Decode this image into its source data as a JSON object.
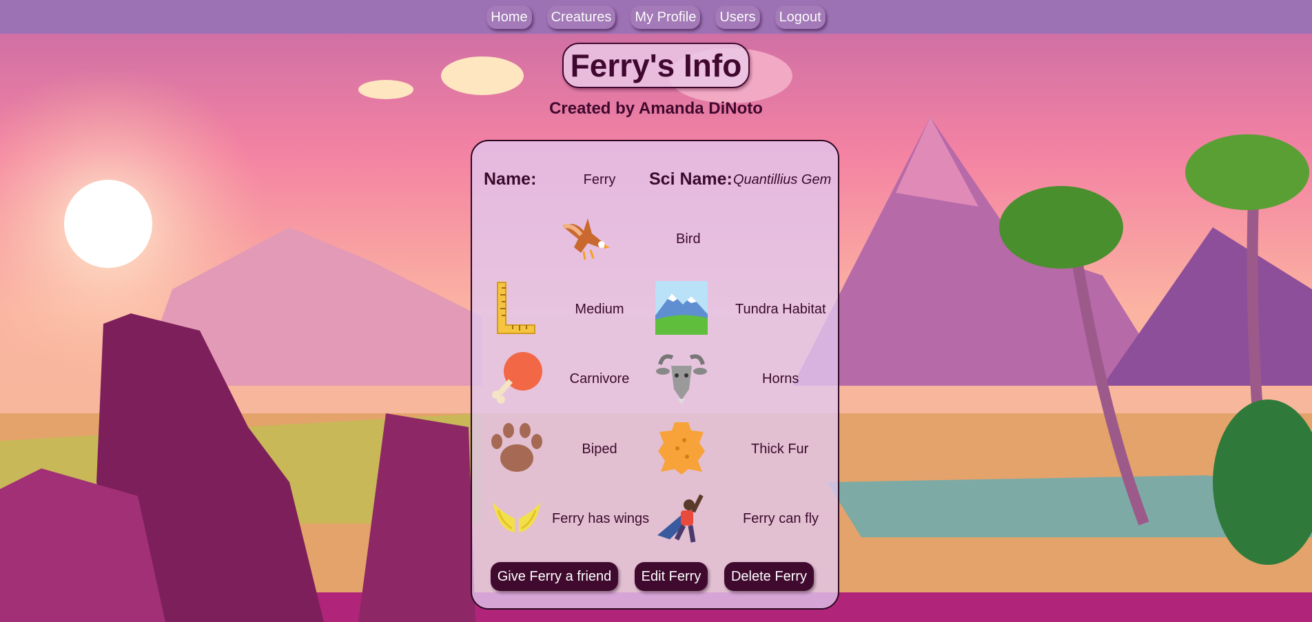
{
  "nav": {
    "items": [
      {
        "label": "Home"
      },
      {
        "label": "Creatures"
      },
      {
        "label": "My Profile"
      },
      {
        "label": "Users"
      },
      {
        "label": "Logout"
      }
    ]
  },
  "header": {
    "title": "Ferry's Info",
    "subtitle": "Created by Amanda DiNoto"
  },
  "creature": {
    "name_label": "Name:",
    "name": "Ferry",
    "sci_label": "Sci Name:",
    "sci_name": "Quantillius Gem",
    "type": "Bird",
    "size": "Medium",
    "habitat": "Tundra Habitat",
    "diet": "Carnivore",
    "feature": "Horns",
    "movement": "Biped",
    "covering": "Thick Fur",
    "wings": "Ferry has wings",
    "flight": "Ferry can fly"
  },
  "actions": {
    "friend": "Give Ferry a friend",
    "edit": "Edit Ferry",
    "delete": "Delete Ferry"
  },
  "icons": [
    "eagle-icon",
    "ruler-icon",
    "mountain-icon",
    "meat-drumstick-icon",
    "goat-icon",
    "paw-print-icon",
    "fur-pelt-icon",
    "wings-icon",
    "superhero-icon"
  ],
  "colors": {
    "nav": "#9d72b4",
    "text": "#40082e",
    "button": "#3f0a2e"
  }
}
